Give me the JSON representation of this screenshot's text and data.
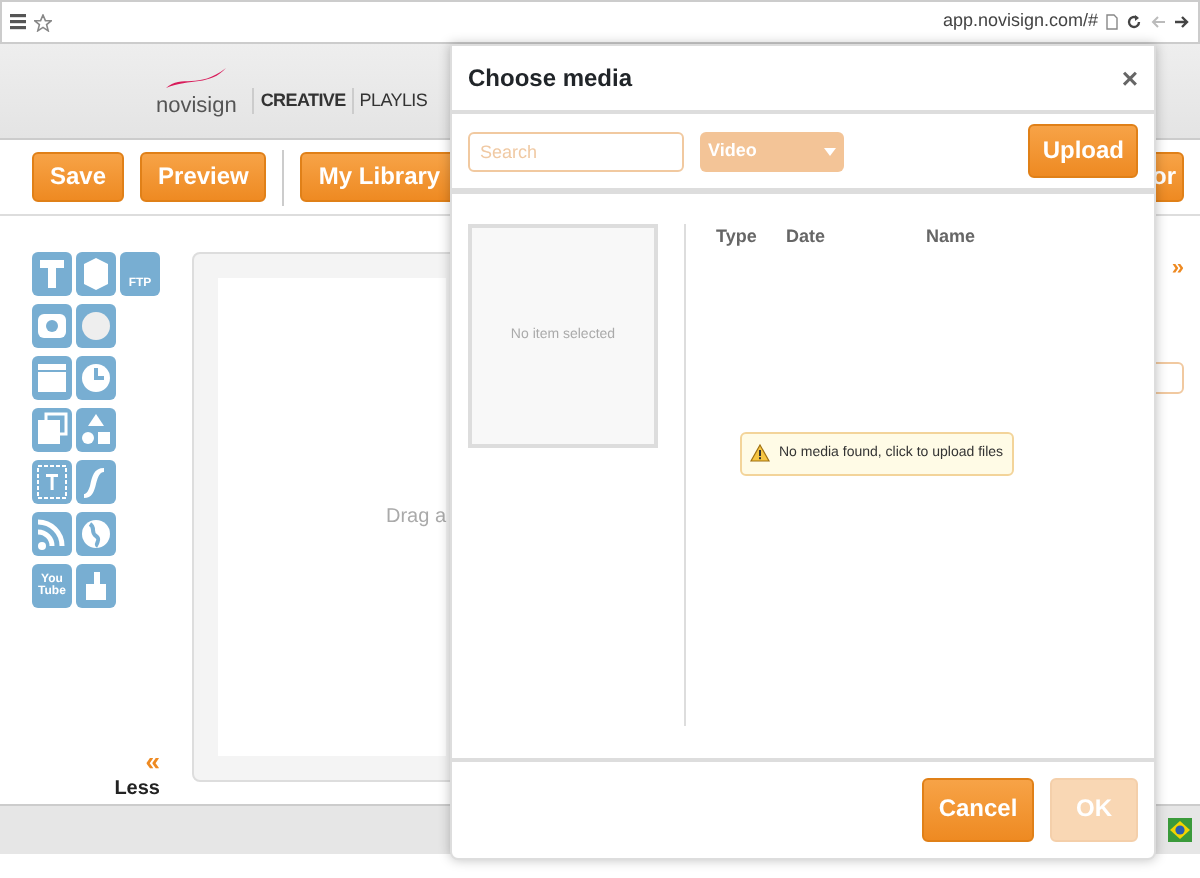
{
  "browser": {
    "url": "app.novisign.com/#"
  },
  "header": {
    "logo": "novisign",
    "nav": [
      {
        "label": "CREATIVE",
        "selected": true
      },
      {
        "label": "PLAYLIS",
        "selected": false
      }
    ]
  },
  "toolbar": {
    "buttons": [
      {
        "label": "Save"
      },
      {
        "label": "Preview"
      },
      {
        "label": "My Library"
      }
    ],
    "right_button": "or"
  },
  "tools": [
    {
      "kind": "text"
    },
    {
      "kind": "dice"
    },
    {
      "kind": "ftp",
      "label": "FTP"
    },
    {
      "kind": "camera"
    },
    {
      "kind": "sun"
    },
    {
      "kind": "clapper"
    },
    {
      "kind": "clock"
    },
    {
      "kind": "photos"
    },
    {
      "kind": "shapes"
    },
    {
      "kind": "textbox"
    },
    {
      "kind": "flash"
    },
    {
      "kind": "rss"
    },
    {
      "kind": "globe"
    },
    {
      "kind": "youtube",
      "label": "You Tube"
    },
    {
      "kind": "hand"
    }
  ],
  "less": {
    "arrow": "«",
    "label": "Less"
  },
  "canvas": {
    "hint": "Drag a"
  },
  "right_panel": {
    "arrow": "»"
  },
  "modal": {
    "title": "Choose media",
    "close": "×",
    "search": {
      "placeholder": "Search"
    },
    "filter": "Video",
    "upload": "Upload",
    "preview": "No item selected",
    "columns": [
      "Type",
      "Date",
      "Name"
    ],
    "message": "No media found, click to upload files",
    "buttons": [
      {
        "label": "Cancel",
        "disabled": false
      },
      {
        "label": "OK",
        "disabled": true
      }
    ]
  }
}
